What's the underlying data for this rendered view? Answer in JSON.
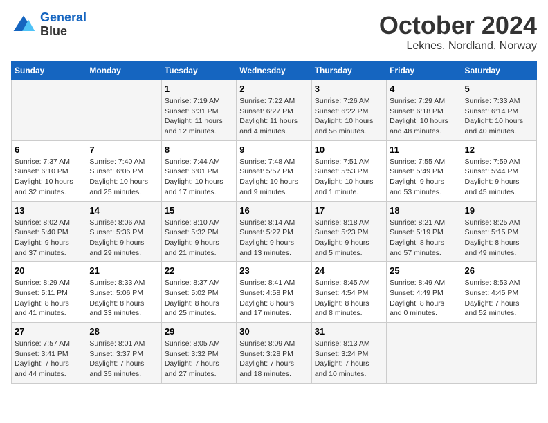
{
  "header": {
    "logo_line1": "General",
    "logo_line2": "Blue",
    "month": "October 2024",
    "location": "Leknes, Nordland, Norway"
  },
  "weekdays": [
    "Sunday",
    "Monday",
    "Tuesday",
    "Wednesday",
    "Thursday",
    "Friday",
    "Saturday"
  ],
  "weeks": [
    [
      {
        "day": null,
        "info": null
      },
      {
        "day": null,
        "info": null
      },
      {
        "day": "1",
        "info": "Sunrise: 7:19 AM\nSunset: 6:31 PM\nDaylight: 11 hours\nand 12 minutes."
      },
      {
        "day": "2",
        "info": "Sunrise: 7:22 AM\nSunset: 6:27 PM\nDaylight: 11 hours\nand 4 minutes."
      },
      {
        "day": "3",
        "info": "Sunrise: 7:26 AM\nSunset: 6:22 PM\nDaylight: 10 hours\nand 56 minutes."
      },
      {
        "day": "4",
        "info": "Sunrise: 7:29 AM\nSunset: 6:18 PM\nDaylight: 10 hours\nand 48 minutes."
      },
      {
        "day": "5",
        "info": "Sunrise: 7:33 AM\nSunset: 6:14 PM\nDaylight: 10 hours\nand 40 minutes."
      }
    ],
    [
      {
        "day": "6",
        "info": "Sunrise: 7:37 AM\nSunset: 6:10 PM\nDaylight: 10 hours\nand 32 minutes."
      },
      {
        "day": "7",
        "info": "Sunrise: 7:40 AM\nSunset: 6:05 PM\nDaylight: 10 hours\nand 25 minutes."
      },
      {
        "day": "8",
        "info": "Sunrise: 7:44 AM\nSunset: 6:01 PM\nDaylight: 10 hours\nand 17 minutes."
      },
      {
        "day": "9",
        "info": "Sunrise: 7:48 AM\nSunset: 5:57 PM\nDaylight: 10 hours\nand 9 minutes."
      },
      {
        "day": "10",
        "info": "Sunrise: 7:51 AM\nSunset: 5:53 PM\nDaylight: 10 hours\nand 1 minute."
      },
      {
        "day": "11",
        "info": "Sunrise: 7:55 AM\nSunset: 5:49 PM\nDaylight: 9 hours\nand 53 minutes."
      },
      {
        "day": "12",
        "info": "Sunrise: 7:59 AM\nSunset: 5:44 PM\nDaylight: 9 hours\nand 45 minutes."
      }
    ],
    [
      {
        "day": "13",
        "info": "Sunrise: 8:02 AM\nSunset: 5:40 PM\nDaylight: 9 hours\nand 37 minutes."
      },
      {
        "day": "14",
        "info": "Sunrise: 8:06 AM\nSunset: 5:36 PM\nDaylight: 9 hours\nand 29 minutes."
      },
      {
        "day": "15",
        "info": "Sunrise: 8:10 AM\nSunset: 5:32 PM\nDaylight: 9 hours\nand 21 minutes."
      },
      {
        "day": "16",
        "info": "Sunrise: 8:14 AM\nSunset: 5:27 PM\nDaylight: 9 hours\nand 13 minutes."
      },
      {
        "day": "17",
        "info": "Sunrise: 8:18 AM\nSunset: 5:23 PM\nDaylight: 9 hours\nand 5 minutes."
      },
      {
        "day": "18",
        "info": "Sunrise: 8:21 AM\nSunset: 5:19 PM\nDaylight: 8 hours\nand 57 minutes."
      },
      {
        "day": "19",
        "info": "Sunrise: 8:25 AM\nSunset: 5:15 PM\nDaylight: 8 hours\nand 49 minutes."
      }
    ],
    [
      {
        "day": "20",
        "info": "Sunrise: 8:29 AM\nSunset: 5:11 PM\nDaylight: 8 hours\nand 41 minutes."
      },
      {
        "day": "21",
        "info": "Sunrise: 8:33 AM\nSunset: 5:06 PM\nDaylight: 8 hours\nand 33 minutes."
      },
      {
        "day": "22",
        "info": "Sunrise: 8:37 AM\nSunset: 5:02 PM\nDaylight: 8 hours\nand 25 minutes."
      },
      {
        "day": "23",
        "info": "Sunrise: 8:41 AM\nSunset: 4:58 PM\nDaylight: 8 hours\nand 17 minutes."
      },
      {
        "day": "24",
        "info": "Sunrise: 8:45 AM\nSunset: 4:54 PM\nDaylight: 8 hours\nand 8 minutes."
      },
      {
        "day": "25",
        "info": "Sunrise: 8:49 AM\nSunset: 4:49 PM\nDaylight: 8 hours\nand 0 minutes."
      },
      {
        "day": "26",
        "info": "Sunrise: 8:53 AM\nSunset: 4:45 PM\nDaylight: 7 hours\nand 52 minutes."
      }
    ],
    [
      {
        "day": "27",
        "info": "Sunrise: 7:57 AM\nSunset: 3:41 PM\nDaylight: 7 hours\nand 44 minutes."
      },
      {
        "day": "28",
        "info": "Sunrise: 8:01 AM\nSunset: 3:37 PM\nDaylight: 7 hours\nand 35 minutes."
      },
      {
        "day": "29",
        "info": "Sunrise: 8:05 AM\nSunset: 3:32 PM\nDaylight: 7 hours\nand 27 minutes."
      },
      {
        "day": "30",
        "info": "Sunrise: 8:09 AM\nSunset: 3:28 PM\nDaylight: 7 hours\nand 18 minutes."
      },
      {
        "day": "31",
        "info": "Sunrise: 8:13 AM\nSunset: 3:24 PM\nDaylight: 7 hours\nand 10 minutes."
      },
      {
        "day": null,
        "info": null
      },
      {
        "day": null,
        "info": null
      }
    ]
  ]
}
